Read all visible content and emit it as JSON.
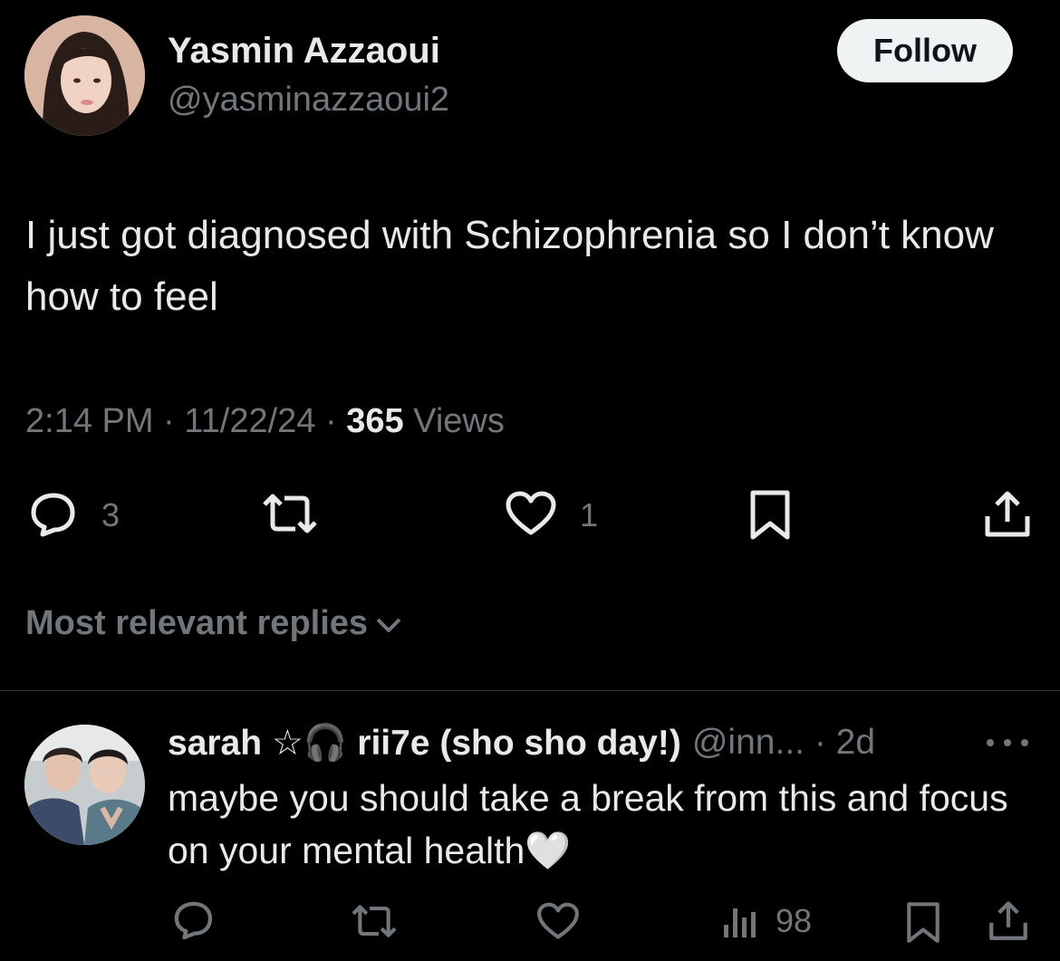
{
  "tweet": {
    "author_name": "Yasmin Azzaoui",
    "author_handle": "@yasminazzaoui2",
    "follow_label": "Follow",
    "text": "I just got diagnosed with Schizophrenia so I don’t know how to feel",
    "time": "2:14 PM",
    "date": "11/22/24",
    "views_count": "365",
    "views_label": "Views",
    "separator": "·",
    "replies_count": "3",
    "likes_count": "1",
    "icons": [
      "reply-icon",
      "retweet-icon",
      "like-icon",
      "bookmark-icon",
      "share-icon"
    ]
  },
  "replies_section": {
    "sort_label": "Most relevant replies"
  },
  "reply": {
    "display_name": "sarah ☆🎧 rii7e (sho sho day!)",
    "handle_time": "@inn... · 2d",
    "text": "maybe you should take a break from this and focus on your mental health🤍",
    "views_count": "98",
    "icons": [
      "reply-icon",
      "retweet-icon",
      "like-icon",
      "views-icon",
      "bookmark-icon",
      "share-icon"
    ]
  },
  "colors": {
    "background": "#000000",
    "primary_text": "#e7e9ea",
    "secondary_text": "#71767b",
    "divider": "#2f3336",
    "follow_button_bg": "#eff3f4"
  }
}
